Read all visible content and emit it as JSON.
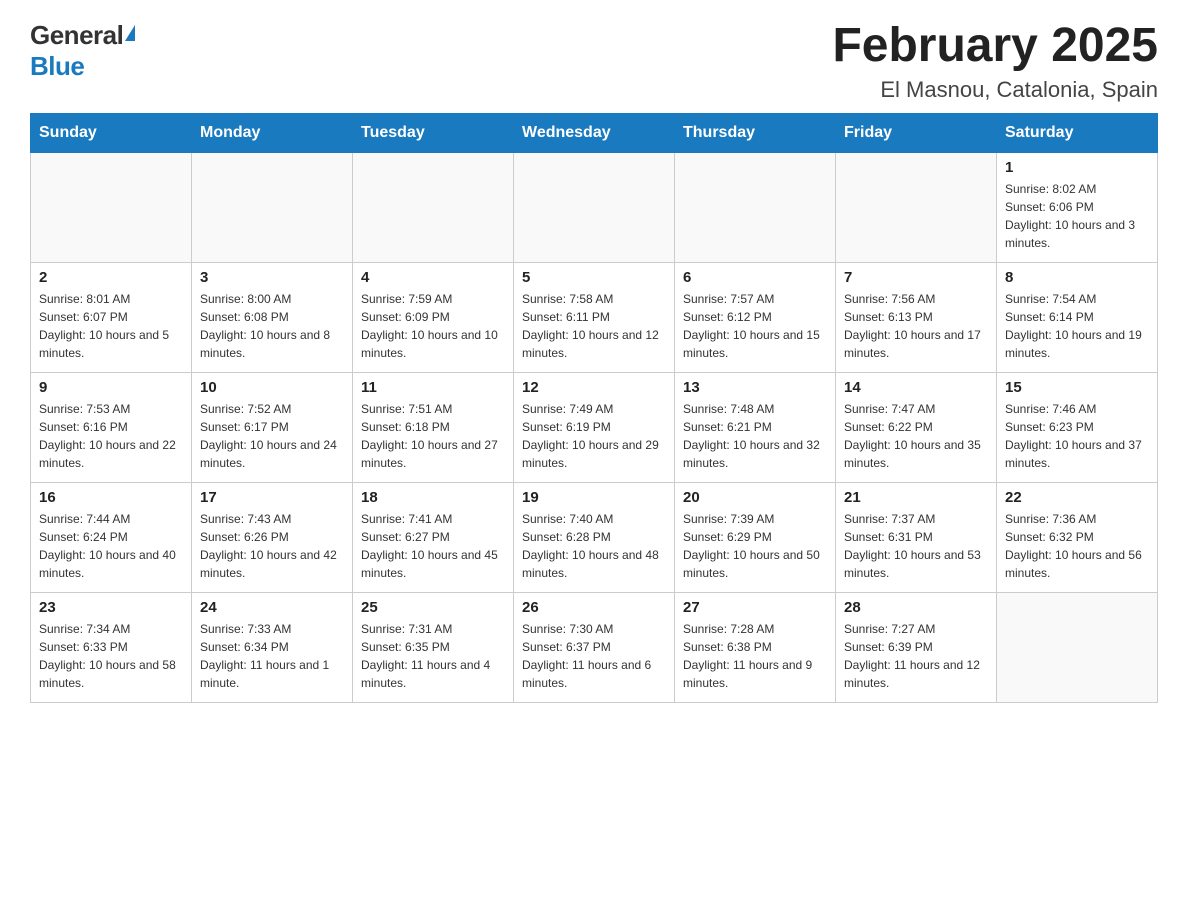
{
  "logo": {
    "general": "General",
    "blue": "Blue"
  },
  "header": {
    "title": "February 2025",
    "location": "El Masnou, Catalonia, Spain"
  },
  "days_of_week": [
    "Sunday",
    "Monday",
    "Tuesday",
    "Wednesday",
    "Thursday",
    "Friday",
    "Saturday"
  ],
  "weeks": [
    [
      {
        "day": "",
        "sunrise": "",
        "sunset": "",
        "daylight": ""
      },
      {
        "day": "",
        "sunrise": "",
        "sunset": "",
        "daylight": ""
      },
      {
        "day": "",
        "sunrise": "",
        "sunset": "",
        "daylight": ""
      },
      {
        "day": "",
        "sunrise": "",
        "sunset": "",
        "daylight": ""
      },
      {
        "day": "",
        "sunrise": "",
        "sunset": "",
        "daylight": ""
      },
      {
        "day": "",
        "sunrise": "",
        "sunset": "",
        "daylight": ""
      },
      {
        "day": "1",
        "sunrise": "Sunrise: 8:02 AM",
        "sunset": "Sunset: 6:06 PM",
        "daylight": "Daylight: 10 hours and 3 minutes."
      }
    ],
    [
      {
        "day": "2",
        "sunrise": "Sunrise: 8:01 AM",
        "sunset": "Sunset: 6:07 PM",
        "daylight": "Daylight: 10 hours and 5 minutes."
      },
      {
        "day": "3",
        "sunrise": "Sunrise: 8:00 AM",
        "sunset": "Sunset: 6:08 PM",
        "daylight": "Daylight: 10 hours and 8 minutes."
      },
      {
        "day": "4",
        "sunrise": "Sunrise: 7:59 AM",
        "sunset": "Sunset: 6:09 PM",
        "daylight": "Daylight: 10 hours and 10 minutes."
      },
      {
        "day": "5",
        "sunrise": "Sunrise: 7:58 AM",
        "sunset": "Sunset: 6:11 PM",
        "daylight": "Daylight: 10 hours and 12 minutes."
      },
      {
        "day": "6",
        "sunrise": "Sunrise: 7:57 AM",
        "sunset": "Sunset: 6:12 PM",
        "daylight": "Daylight: 10 hours and 15 minutes."
      },
      {
        "day": "7",
        "sunrise": "Sunrise: 7:56 AM",
        "sunset": "Sunset: 6:13 PM",
        "daylight": "Daylight: 10 hours and 17 minutes."
      },
      {
        "day": "8",
        "sunrise": "Sunrise: 7:54 AM",
        "sunset": "Sunset: 6:14 PM",
        "daylight": "Daylight: 10 hours and 19 minutes."
      }
    ],
    [
      {
        "day": "9",
        "sunrise": "Sunrise: 7:53 AM",
        "sunset": "Sunset: 6:16 PM",
        "daylight": "Daylight: 10 hours and 22 minutes."
      },
      {
        "day": "10",
        "sunrise": "Sunrise: 7:52 AM",
        "sunset": "Sunset: 6:17 PM",
        "daylight": "Daylight: 10 hours and 24 minutes."
      },
      {
        "day": "11",
        "sunrise": "Sunrise: 7:51 AM",
        "sunset": "Sunset: 6:18 PM",
        "daylight": "Daylight: 10 hours and 27 minutes."
      },
      {
        "day": "12",
        "sunrise": "Sunrise: 7:49 AM",
        "sunset": "Sunset: 6:19 PM",
        "daylight": "Daylight: 10 hours and 29 minutes."
      },
      {
        "day": "13",
        "sunrise": "Sunrise: 7:48 AM",
        "sunset": "Sunset: 6:21 PM",
        "daylight": "Daylight: 10 hours and 32 minutes."
      },
      {
        "day": "14",
        "sunrise": "Sunrise: 7:47 AM",
        "sunset": "Sunset: 6:22 PM",
        "daylight": "Daylight: 10 hours and 35 minutes."
      },
      {
        "day": "15",
        "sunrise": "Sunrise: 7:46 AM",
        "sunset": "Sunset: 6:23 PM",
        "daylight": "Daylight: 10 hours and 37 minutes."
      }
    ],
    [
      {
        "day": "16",
        "sunrise": "Sunrise: 7:44 AM",
        "sunset": "Sunset: 6:24 PM",
        "daylight": "Daylight: 10 hours and 40 minutes."
      },
      {
        "day": "17",
        "sunrise": "Sunrise: 7:43 AM",
        "sunset": "Sunset: 6:26 PM",
        "daylight": "Daylight: 10 hours and 42 minutes."
      },
      {
        "day": "18",
        "sunrise": "Sunrise: 7:41 AM",
        "sunset": "Sunset: 6:27 PM",
        "daylight": "Daylight: 10 hours and 45 minutes."
      },
      {
        "day": "19",
        "sunrise": "Sunrise: 7:40 AM",
        "sunset": "Sunset: 6:28 PM",
        "daylight": "Daylight: 10 hours and 48 minutes."
      },
      {
        "day": "20",
        "sunrise": "Sunrise: 7:39 AM",
        "sunset": "Sunset: 6:29 PM",
        "daylight": "Daylight: 10 hours and 50 minutes."
      },
      {
        "day": "21",
        "sunrise": "Sunrise: 7:37 AM",
        "sunset": "Sunset: 6:31 PM",
        "daylight": "Daylight: 10 hours and 53 minutes."
      },
      {
        "day": "22",
        "sunrise": "Sunrise: 7:36 AM",
        "sunset": "Sunset: 6:32 PM",
        "daylight": "Daylight: 10 hours and 56 minutes."
      }
    ],
    [
      {
        "day": "23",
        "sunrise": "Sunrise: 7:34 AM",
        "sunset": "Sunset: 6:33 PM",
        "daylight": "Daylight: 10 hours and 58 minutes."
      },
      {
        "day": "24",
        "sunrise": "Sunrise: 7:33 AM",
        "sunset": "Sunset: 6:34 PM",
        "daylight": "Daylight: 11 hours and 1 minute."
      },
      {
        "day": "25",
        "sunrise": "Sunrise: 7:31 AM",
        "sunset": "Sunset: 6:35 PM",
        "daylight": "Daylight: 11 hours and 4 minutes."
      },
      {
        "day": "26",
        "sunrise": "Sunrise: 7:30 AM",
        "sunset": "Sunset: 6:37 PM",
        "daylight": "Daylight: 11 hours and 6 minutes."
      },
      {
        "day": "27",
        "sunrise": "Sunrise: 7:28 AM",
        "sunset": "Sunset: 6:38 PM",
        "daylight": "Daylight: 11 hours and 9 minutes."
      },
      {
        "day": "28",
        "sunrise": "Sunrise: 7:27 AM",
        "sunset": "Sunset: 6:39 PM",
        "daylight": "Daylight: 11 hours and 12 minutes."
      },
      {
        "day": "",
        "sunrise": "",
        "sunset": "",
        "daylight": ""
      }
    ]
  ]
}
